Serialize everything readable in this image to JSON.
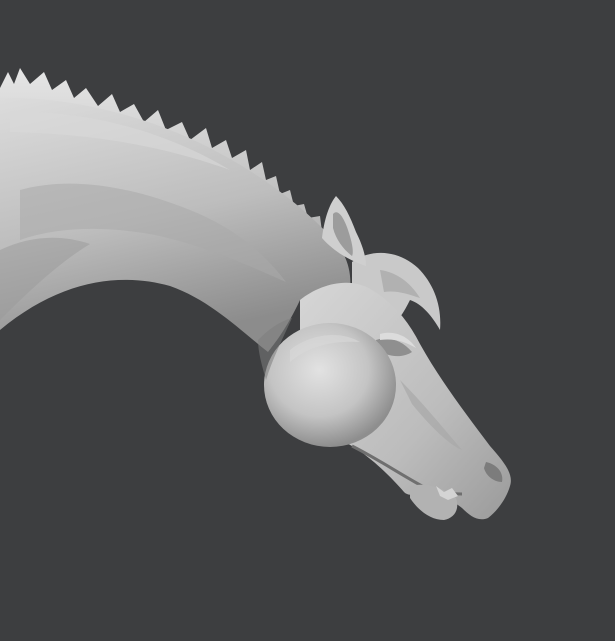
{
  "scene": {
    "background_color": "#3d3e40",
    "subject": "sculpted-horse-head-and-neck",
    "material_colors": {
      "highlight": "#dedede",
      "base": "#bcbcbc",
      "shadow": "#8a8a8a",
      "deep_shadow": "#5e5e5e"
    }
  }
}
